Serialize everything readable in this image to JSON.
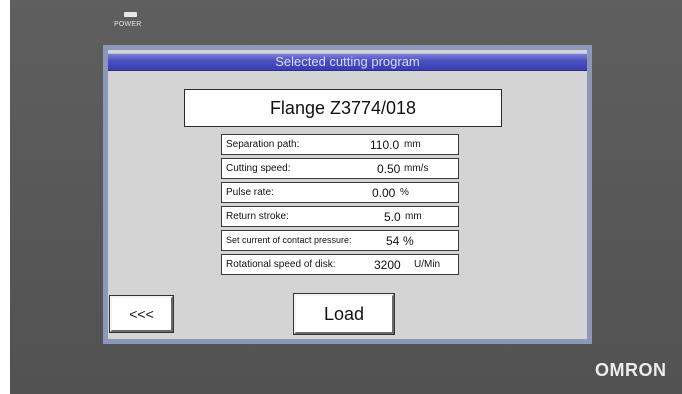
{
  "device": {
    "power_label": "POWER",
    "brand": "OMRON"
  },
  "screen": {
    "title": "Selected cutting program",
    "program_name": "Flange Z3774/018",
    "params": [
      {
        "label": "Separation path:",
        "value": "110.0",
        "unit": "mm"
      },
      {
        "label": "Cutting speed:",
        "value": "0.50",
        "unit": "mm/s"
      },
      {
        "label": "Pulse rate:",
        "value": "0.00",
        "unit": "%"
      },
      {
        "label": "Return stroke:",
        "value": "5.0",
        "unit": "mm"
      },
      {
        "label": "Set current of contact pressure:",
        "value": "54",
        "unit": "%"
      },
      {
        "label": "Rotational speed of disk:",
        "value": "3200",
        "unit": "U/Min"
      }
    ],
    "back_button": "<<<",
    "load_button": "Load"
  },
  "colors": {
    "bezel": "#5a5a5a",
    "screen_bg": "#d4d4d4",
    "title_bar": "#4a4ec0",
    "title_text": "#d8dcff"
  }
}
